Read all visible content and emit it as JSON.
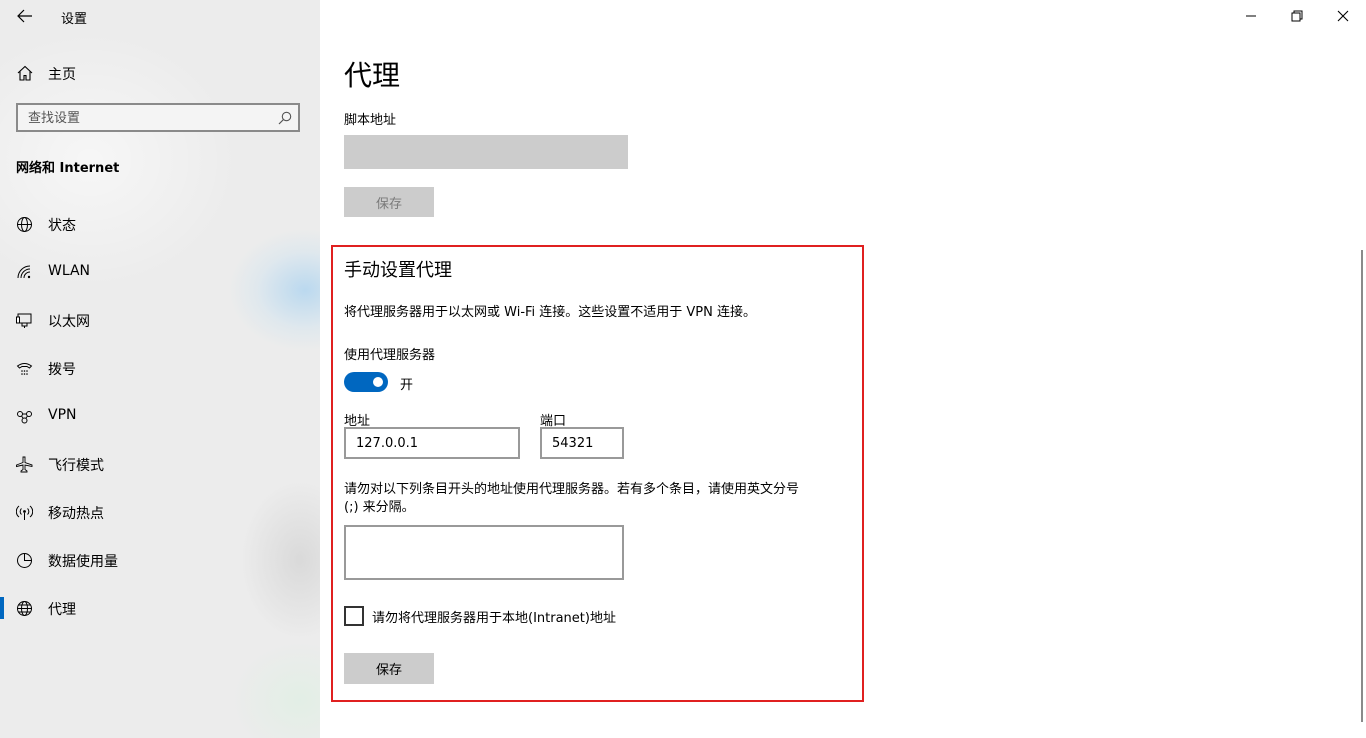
{
  "window": {
    "title": "设置"
  },
  "sidebar": {
    "home_label": "主页",
    "search_placeholder": "查找设置",
    "section_title": "网络和 Internet",
    "items": [
      {
        "label": "状态",
        "icon": "globe-status-icon"
      },
      {
        "label": "WLAN",
        "icon": "wifi-icon"
      },
      {
        "label": "以太网",
        "icon": "ethernet-icon"
      },
      {
        "label": "拨号",
        "icon": "dialup-icon"
      },
      {
        "label": "VPN",
        "icon": "vpn-icon"
      },
      {
        "label": "飞行模式",
        "icon": "airplane-icon"
      },
      {
        "label": "移动热点",
        "icon": "hotspot-icon"
      },
      {
        "label": "数据使用量",
        "icon": "data-usage-icon"
      },
      {
        "label": "代理",
        "icon": "globe-icon",
        "active": true
      }
    ]
  },
  "main": {
    "page_title": "代理",
    "script_address_label": "脚本地址",
    "script_address_value": "",
    "script_save_label": "保存",
    "manual": {
      "title": "手动设置代理",
      "description": "将代理服务器用于以太网或 Wi-Fi 连接。这些设置不适用于 VPN 连接。",
      "use_proxy_label": "使用代理服务器",
      "toggle_state": "开",
      "toggle_on": true,
      "address_label": "地址",
      "address_value": "127.0.0.1",
      "port_label": "端口",
      "port_value": "54321",
      "exclude_description": "请勿对以下列条目开头的地址使用代理服务器。若有多个条目，请使用英文分号 (;) 来分隔。",
      "exclude_value": "",
      "bypass_local_label": "请勿将代理服务器用于本地(Intranet)地址",
      "bypass_local_checked": false,
      "save_label": "保存"
    }
  },
  "colors": {
    "accent": "#0067c0",
    "highlight_border": "#e02020",
    "sidebar_bg": "#ececec",
    "button_bg": "#cccccc"
  }
}
